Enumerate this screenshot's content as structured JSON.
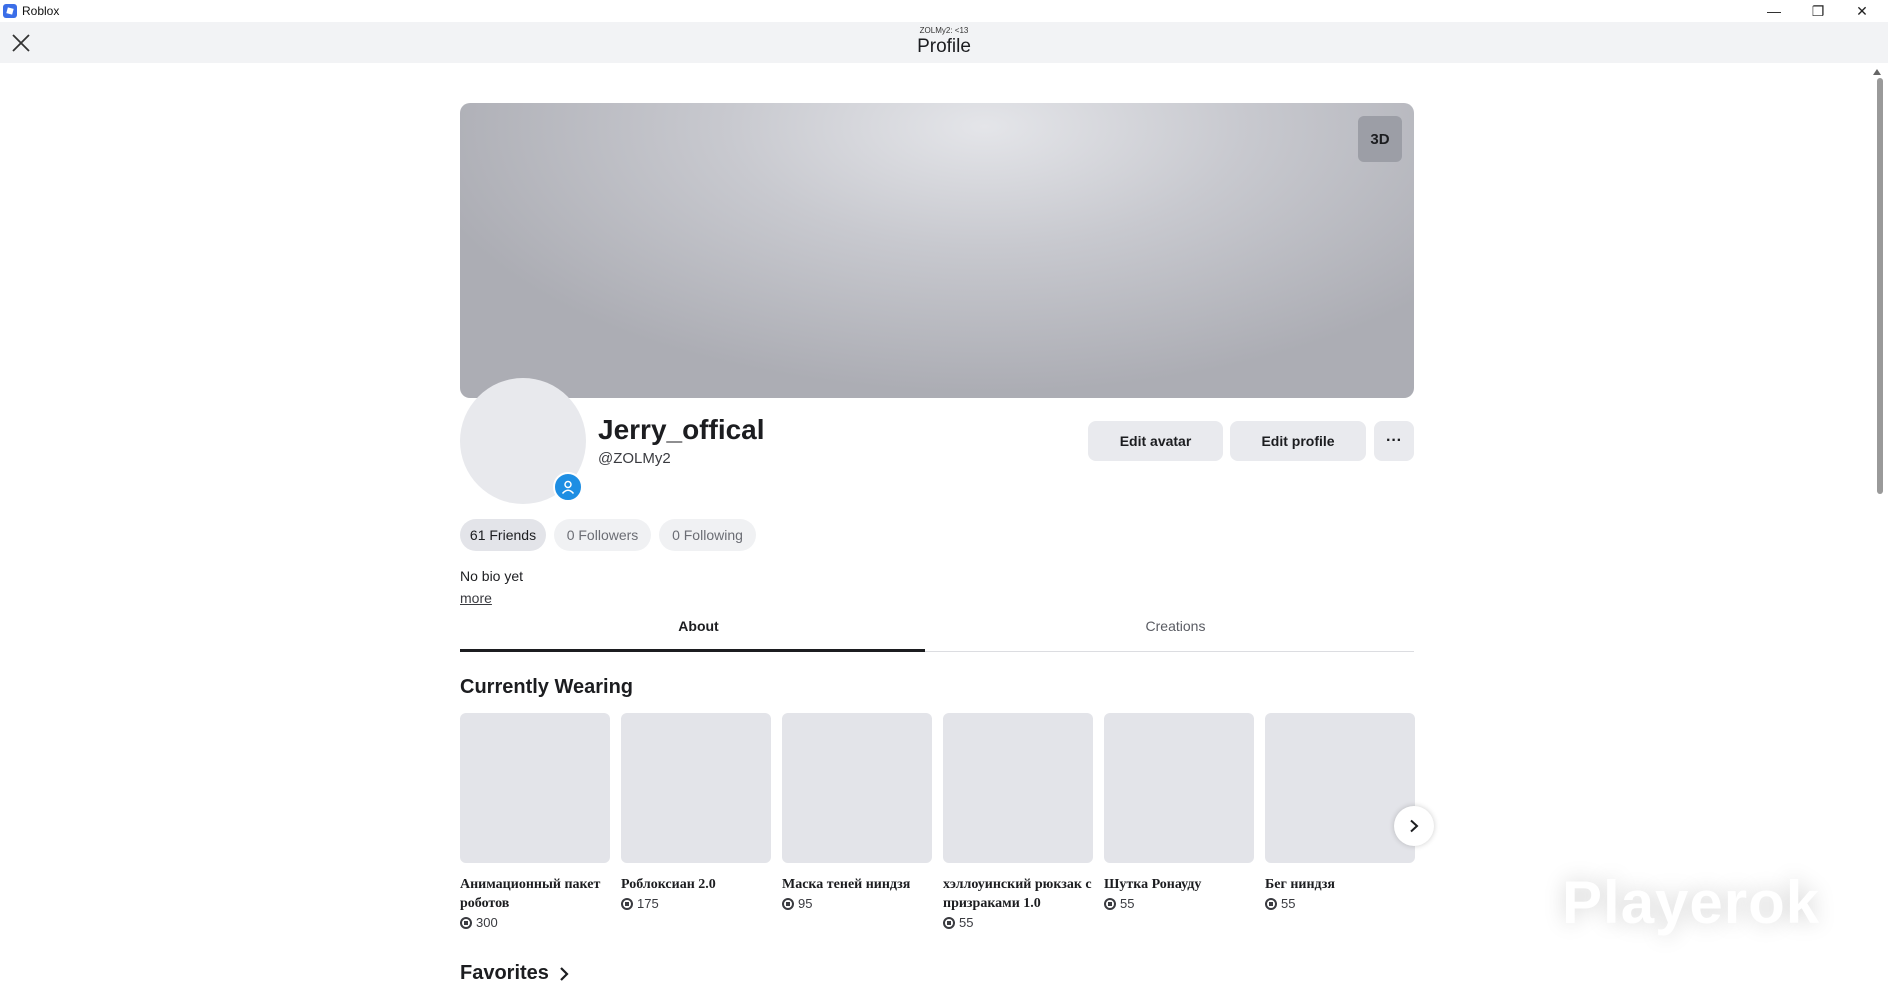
{
  "window": {
    "app_title": "Roblox",
    "minimize": "—",
    "restore": "❐",
    "close": "✕"
  },
  "header": {
    "subtitle": "ZOLMy2: <13",
    "title": "Profile"
  },
  "banner": {
    "view_3d_label": "3D"
  },
  "profile": {
    "display_name": "Jerry_offical",
    "username": "@ZOLMy2",
    "bio": "No bio yet",
    "more_link": "more"
  },
  "actions": {
    "edit_avatar": "Edit avatar",
    "edit_profile": "Edit profile",
    "more_options": "···"
  },
  "stats": {
    "friends": "61 Friends",
    "followers": "0 Followers",
    "following": "0 Following"
  },
  "tabs": [
    {
      "label": "About"
    },
    {
      "label": "Creations"
    }
  ],
  "currently_wearing": {
    "title": "Currently Wearing",
    "items": [
      {
        "name": "Анимационный пакет роботов",
        "price": "300"
      },
      {
        "name": "Роблоксиан 2.0",
        "price": "175"
      },
      {
        "name": "Маска теней ниндзя",
        "price": "95"
      },
      {
        "name": "хэллоуинский рюкзак с призраками 1.0",
        "price": "55"
      },
      {
        "name": "Шутка Ронауду",
        "price": "55"
      },
      {
        "name": "Бег ниндзя",
        "price": "55"
      }
    ]
  },
  "favorites": {
    "title": "Favorites"
  },
  "watermark": {
    "text": "Playerok"
  },
  "icons": {
    "close": "close-icon",
    "next": "chevron-right-icon",
    "badge": "person-icon",
    "robux": "robux-icon"
  }
}
